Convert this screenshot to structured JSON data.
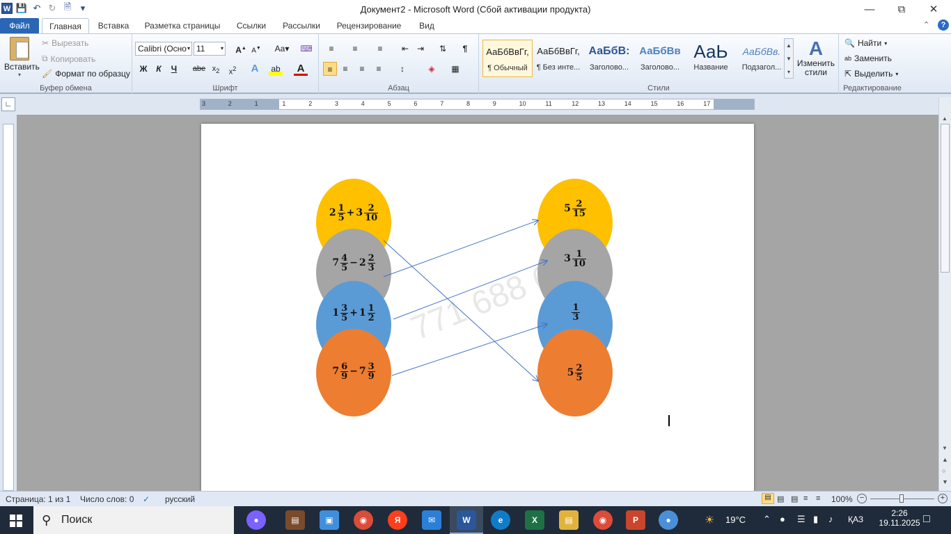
{
  "window": {
    "title": "Документ2 - Microsoft Word (Сбой активации продукта)"
  },
  "tabs": {
    "file": "Файл",
    "items": [
      "Главная",
      "Вставка",
      "Разметка страницы",
      "Ссылки",
      "Рассылки",
      "Рецензирование",
      "Вид"
    ]
  },
  "clipboard": {
    "paste": "Вставить",
    "cut": "Вырезать",
    "copy": "Копировать",
    "format": "Формат по образцу",
    "label": "Буфер обмена"
  },
  "font": {
    "name": "Calibri (Осно",
    "size": "11",
    "label": "Шрифт"
  },
  "paragraph": {
    "label": "Абзац"
  },
  "styles": {
    "label": "Стили",
    "items": [
      {
        "sample": "АаБбВвГг,",
        "name": "¶ Обычный"
      },
      {
        "sample": "АаБбВвГг,",
        "name": "¶ Без инте..."
      },
      {
        "sample": "АаБбВ:",
        "name": "Заголово..."
      },
      {
        "sample": "АаБбВв",
        "name": "Заголово..."
      },
      {
        "sample": "АаЬ",
        "name": "Название"
      },
      {
        "sample": "АаБбВв.",
        "name": "Подзагол..."
      }
    ],
    "change": "Изменить стили"
  },
  "editing": {
    "find": "Найти",
    "replace": "Заменить",
    "select": "Выделить",
    "label": "Редактирование"
  },
  "ruler": {
    "numbers": [
      "3",
      "2",
      "1",
      "1",
      "2",
      "3",
      "4",
      "5",
      "6",
      "7",
      "8",
      "9",
      "10",
      "11",
      "12",
      "13",
      "14",
      "15",
      "16",
      "17"
    ]
  },
  "document": {
    "watermark": "771 688 67 17",
    "left": [
      {
        "w1": "2",
        "n1": "1",
        "d1": "5",
        "op": "+",
        "w2": "3",
        "n2": "2",
        "d2": "10",
        "color": "#ffc000"
      },
      {
        "w1": "7",
        "n1": "4",
        "d1": "5",
        "op": "−",
        "w2": "2",
        "n2": "2",
        "d2": "3",
        "color": "#a5a5a5"
      },
      {
        "w1": "1",
        "n1": "3",
        "d1": "5",
        "op": "+",
        "w2": "1",
        "n2": "1",
        "d2": "2",
        "color": "#5b9bd5"
      },
      {
        "w1": "7",
        "n1": "6",
        "d1": "9",
        "op": "−",
        "w2": "7",
        "n2": "3",
        "d2": "9",
        "color": "#ed7d31"
      }
    ],
    "right": [
      {
        "w": "5",
        "n": "2",
        "d": "15",
        "color": "#ffc000"
      },
      {
        "w": "3",
        "n": "1",
        "d": "10",
        "color": "#a5a5a5"
      },
      {
        "w": "",
        "n": "1",
        "d": "3",
        "color": "#5b9bd5"
      },
      {
        "w": "5",
        "n": "2",
        "d": "5",
        "color": "#ed7d31"
      }
    ]
  },
  "status": {
    "page": "Страница: 1 из 1",
    "words": "Число слов: 0",
    "lang": "русский",
    "zoom": "100%"
  },
  "taskbar": {
    "search": "Поиск",
    "weather": "19°C",
    "lang": "ҚАЗ",
    "time": "2:26",
    "date": "19.11.2025"
  }
}
